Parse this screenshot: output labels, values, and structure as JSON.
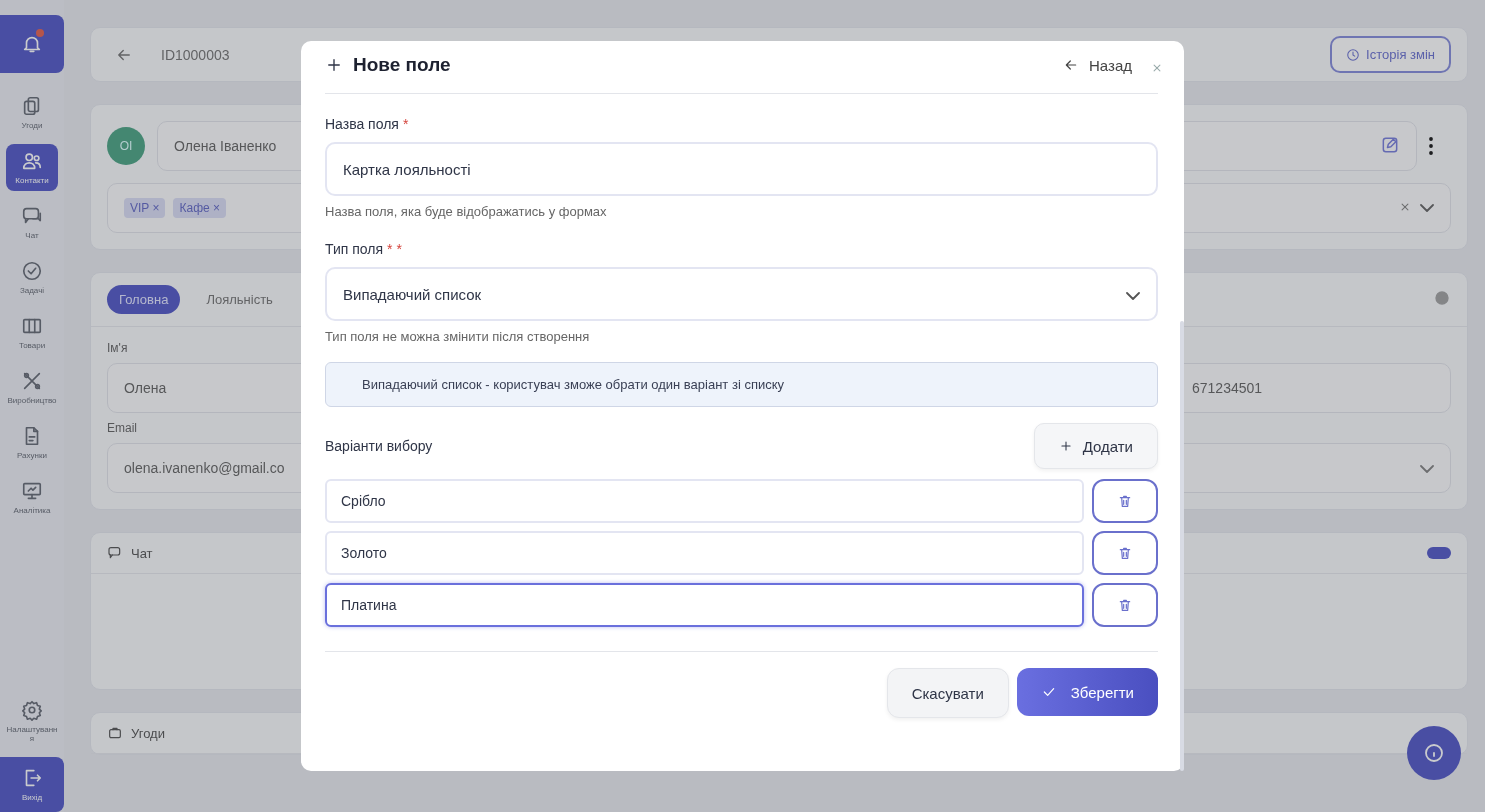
{
  "sidebar": {
    "items": [
      {
        "label": "Угоди",
        "selected": false
      },
      {
        "label": "Контакти",
        "selected": true
      },
      {
        "label": "Чат",
        "selected": false
      },
      {
        "label": "Задачі",
        "selected": false
      },
      {
        "label": "Товари",
        "selected": false
      },
      {
        "label": "Виробництво",
        "selected": false
      },
      {
        "label": "Рахунки",
        "selected": false
      },
      {
        "label": "Аналітика",
        "selected": false
      }
    ],
    "settings": "Налаштування",
    "logout": "Вихід"
  },
  "header": {
    "record_id": "ID1000003",
    "history_button": "Історія змін"
  },
  "contact": {
    "initials": "ОІ",
    "name": "Олена Іваненко",
    "tags": [
      {
        "label": "VIP",
        "remove": "×"
      },
      {
        "label": "Кафе",
        "remove": "×"
      }
    ]
  },
  "details": {
    "tabs": [
      {
        "label": "Головна",
        "selected": true
      },
      {
        "label": "Лояльність",
        "selected": false
      }
    ],
    "first_name_label": "Ім'я",
    "first_name": "Олена",
    "phone": "671234501",
    "email_label": "Email",
    "email": "olena.ivanenko@gmail.co"
  },
  "chat_card": {
    "title": "Чат"
  },
  "deals_card": {
    "title": "Угоди"
  },
  "dialog": {
    "title": "Нове поле",
    "back": "Назад",
    "name_field": {
      "label": "Назва поля",
      "required": "*",
      "value": "Картка лояльності",
      "hint": "Назва поля, яка буде відображатись у формах"
    },
    "type_field": {
      "label": "Тип поля",
      "required": "* *",
      "value": "Випадаючий список",
      "hint": "Тип поля не можна змінити після створення"
    },
    "info": "Випадаючий список - користувач зможе обрати один варіант зі списку",
    "options_label": "Варіанти вибору",
    "add_button": "Додати",
    "options": [
      {
        "value": "Срібло",
        "focused": false
      },
      {
        "value": "Золото",
        "focused": false
      },
      {
        "value": "Платина",
        "focused": true
      }
    ],
    "cancel_button": "Скасувати",
    "save_button": "Зберегти"
  }
}
